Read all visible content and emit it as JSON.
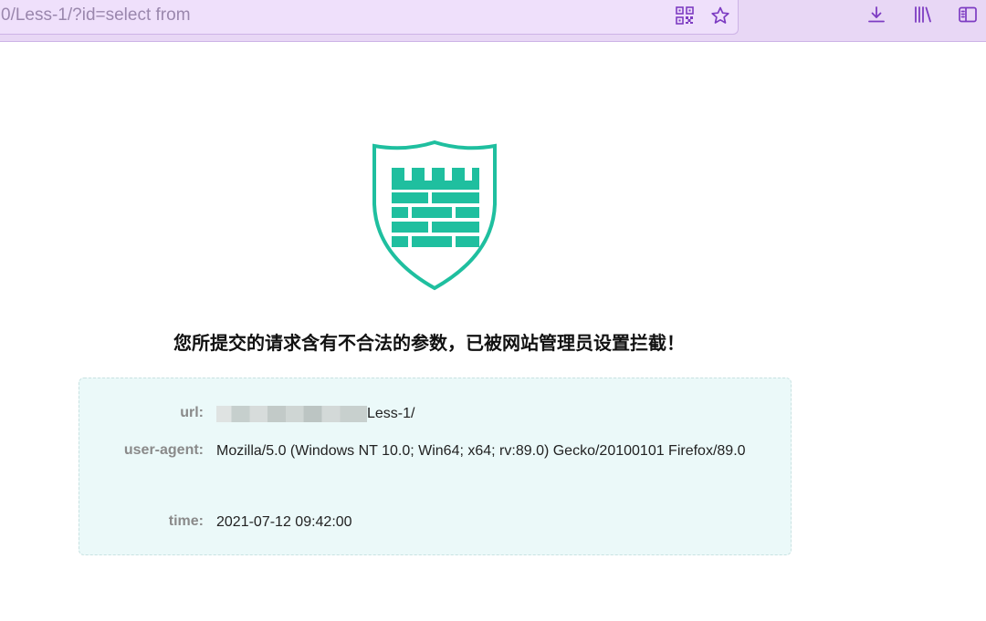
{
  "browser": {
    "url": "0/Less-1/?id=select from",
    "icons": [
      "qr-code-icon",
      "star-icon",
      "download-icon",
      "library-icon",
      "sidebar-icon"
    ]
  },
  "colors": {
    "toolbar": "#e8d7f5",
    "accent": "#7d3cc2",
    "shield": "#1fbf9f",
    "info_bg": "#ebf9f9"
  },
  "block_page": {
    "message": "您所提交的请求含有不合法的参数，已被网站管理员设置拦截！",
    "url_label": "url:",
    "url_value": "Less-1/",
    "ua_label": "user-agent:",
    "ua_value": "Mozilla/5.0 (Windows NT 10.0; Win64; x64; rv:89.0) Gecko/20100101 Firefox/89.0",
    "time_label": "time:",
    "time_value": "2021-07-12 09:42:00"
  }
}
